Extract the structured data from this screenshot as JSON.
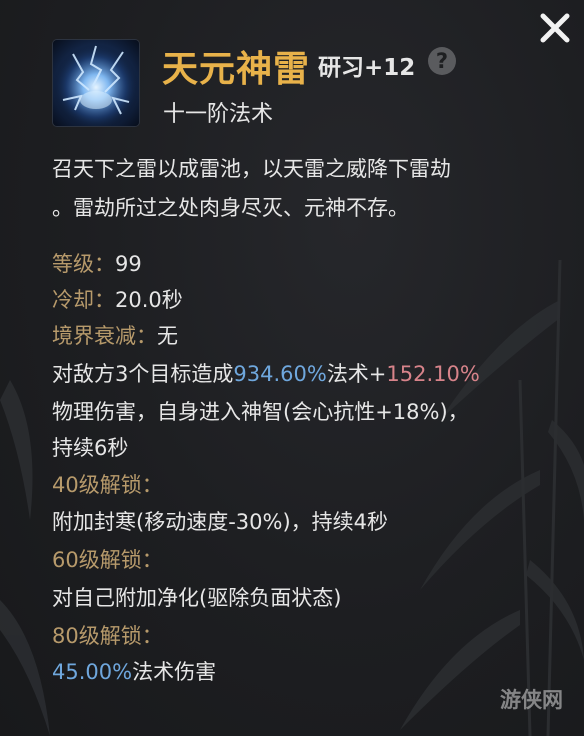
{
  "skill": {
    "name": "天元神雷",
    "research_level": "研习+12",
    "help_symbol": "?",
    "tier": "十一阶法术",
    "icon": "blue-lightning-skill-icon"
  },
  "description": {
    "line1": "召天下之雷以成雷池，以天雷之威降下雷劫",
    "line2": "。雷劫所过之处肉身尽灭、元神不存。"
  },
  "stats": {
    "level_label": "等级：",
    "level_value": "99",
    "cooldown_label": "冷却：",
    "cooldown_value": "20.0秒",
    "decay_label": "境界衰减：",
    "decay_value": "无"
  },
  "effect": {
    "part1": "对敌方3个目标造成",
    "magic_pct": "934.60%",
    "part2": "法术+",
    "physical_pct": "152.10%",
    "line2": "物理伤害，自身进入神智(会心抗性+18%)，",
    "line3": "持续6秒"
  },
  "unlocks": [
    {
      "label": "40级解锁：",
      "text": "附加封寒(移动速度-30%)，持续4秒"
    },
    {
      "label": "60级解锁：",
      "text": "对自己附加净化(驱除负面状态)"
    },
    {
      "label": "80级解锁：",
      "value": "45.00%",
      "suffix": "法术伤害"
    }
  ],
  "watermark": "游侠网",
  "colors": {
    "title_gold": "#e8b24a",
    "label_tan": "#b79a6b",
    "value_blue": "#6fa7dd",
    "value_pink": "#d7838a",
    "text": "#e6e6e6",
    "background": "#1d1e21"
  }
}
